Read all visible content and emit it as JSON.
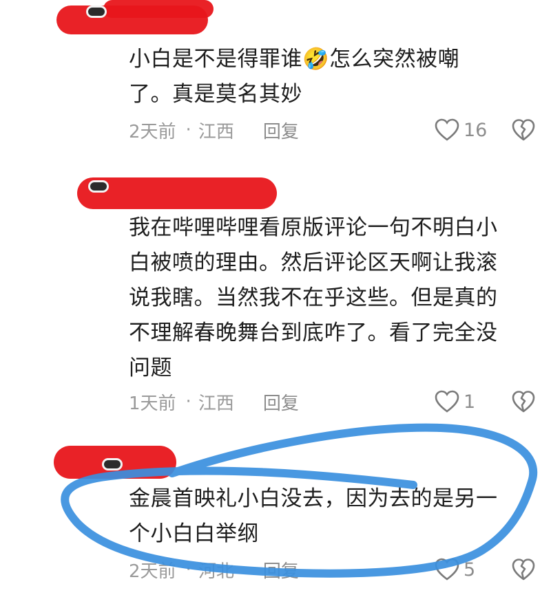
{
  "comments": [
    {
      "text": "小白是不是得罪谁🤣怎么突然被嘲\n了。真是莫名其妙",
      "time": "2天前",
      "location": "江西",
      "reply": "回复",
      "likes": "16"
    },
    {
      "text": "我在哔哩哔哩看原版评论一句不明白小\n白被喷的理由。然后评论区天啊让我滚\n说我瞎。当然我不在乎这些。但是真的\n不理解春晚舞台到底咋了。看了完全没\n问题",
      "time": "1天前",
      "location": "江西",
      "reply": "回复",
      "likes": "1"
    },
    {
      "text": "金晨首映礼小白没去，因为去的是另一\n个小白白举纲",
      "time": "2天前",
      "location": "河北",
      "reply": "回复",
      "likes": "5"
    }
  ],
  "meta_separator": "·",
  "icons": {
    "like": "heart-outline-icon",
    "dislike": "broken-heart-icon"
  },
  "colors": {
    "redaction": "#e8161b",
    "highlight": "#3a8fde",
    "meta": "#9a9a9a"
  }
}
